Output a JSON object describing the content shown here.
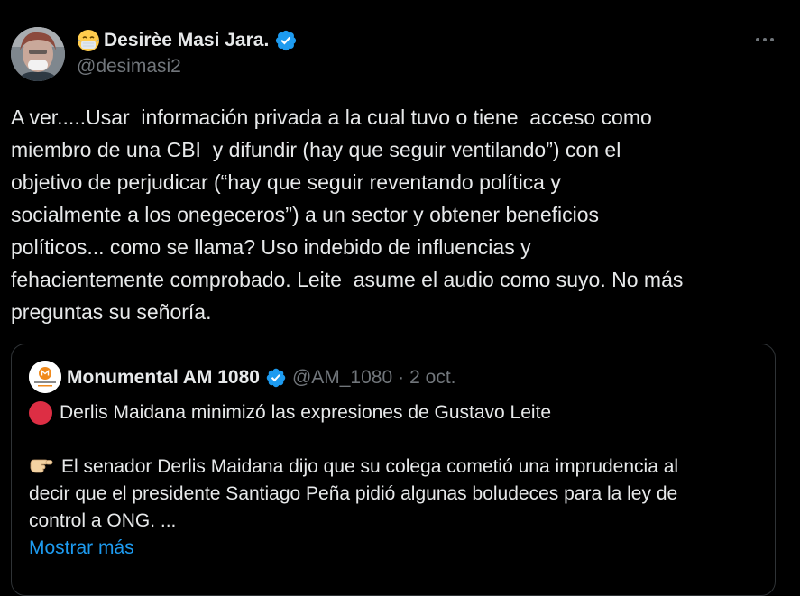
{
  "author": {
    "display_name": "Desirèe Masi Jara.",
    "handle": "@desimasi2",
    "name_emoji": "face-with-medical-mask-icon",
    "verified": true
  },
  "tweet": {
    "text": "A ver.....Usar  información privada a la cual tuvo o tiene  acceso como\nmiembro de una CBI  y difundir (hay que seguir ventilando”) con el\nobjetivo de perjudicar (“hay que seguir reventando política y\nsocialmente a los onegeceros”) a un sector y obtener beneficios\npolíticos... como se llama? Uso indebido de influencias y\nfehacientemente comprobado. Leite  asume el audio como suyo. No más\npreguntas su señoría."
  },
  "quote": {
    "display_name": "Monumental AM 1080",
    "handle": "@AM_1080",
    "separator": "·",
    "date": "2 oct.",
    "verified": true,
    "headline": "Derlis Maidana minimizó las expresiones de Gustavo Leite",
    "body": "El senador Derlis Maidana dijo que su colega cometió una imprudencia al\ndecir que el presidente Santiago Peña pidió algunas boludeces para la ley de\ncontrol a ONG. ...",
    "show_more": "Mostrar más"
  },
  "colors": {
    "background": "#000000",
    "text_primary": "#e7e9ea",
    "text_secondary": "#71767b",
    "accent": "#1d9bf0",
    "border": "#2f3336",
    "verified_badge": "#1d9bf0",
    "red_circle": "#dd2e44"
  }
}
